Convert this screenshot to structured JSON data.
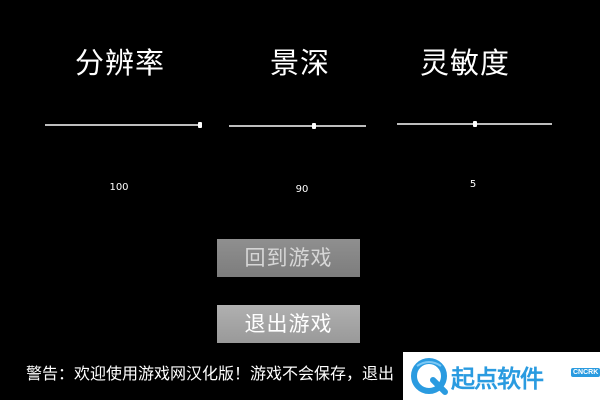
{
  "settings": {
    "columns": [
      {
        "title": "分辨率",
        "value": "100",
        "slider_fraction": 1.0
      },
      {
        "title": "景深",
        "value": "90",
        "slider_fraction": 0.62
      },
      {
        "title": "灵敏度",
        "value": "5",
        "slider_fraction": 0.5
      }
    ]
  },
  "buttons": {
    "return_game": "回到游戏",
    "exit_game": "退出游戏"
  },
  "warning_text": "警告：欢迎使用游戏网汉化版！游戏不会保存，退出",
  "watermark": {
    "brand": "起点软件",
    "sub": "CNCRK",
    "logo_icon": "q-swirl-logo"
  },
  "colors": {
    "background": "#000000",
    "text": "#ffffff",
    "slider_track": "#bdbdbd",
    "button_disabled": "#888888",
    "button_enabled": "#a6a6a6",
    "watermark_blue": "#2a9be0"
  }
}
